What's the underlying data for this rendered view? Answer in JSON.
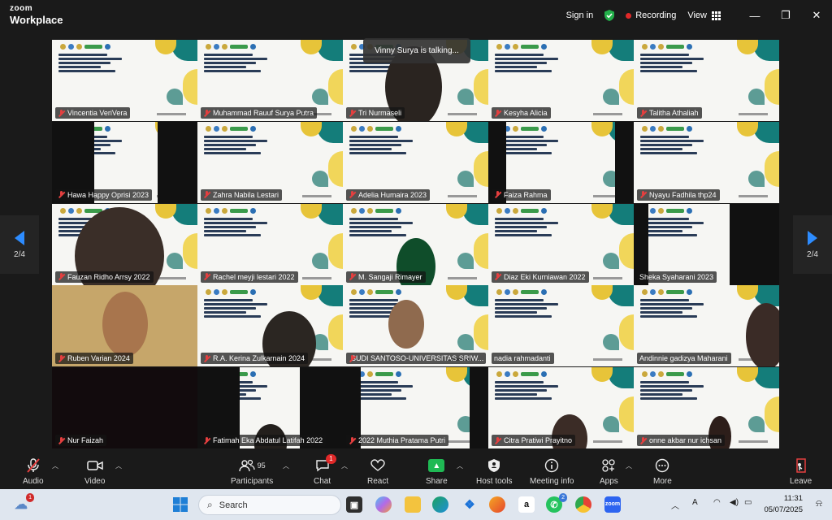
{
  "app": {
    "brand_top": "zoom",
    "brand_bottom": "Workplace"
  },
  "titlebar": {
    "signin": "Sign in",
    "recording": "Recording",
    "view": "View",
    "minimize": "—",
    "maximize": "❐",
    "close": "✕"
  },
  "pager": {
    "left": "2/4",
    "right": "2/4"
  },
  "talking": "Vinny Surya is talking...",
  "participants": [
    {
      "name": "Vincentia VeriVera",
      "muted": true
    },
    {
      "name": "Muhammad Rauuf Surya Putra",
      "muted": true
    },
    {
      "name": "Tri Nurmaseli",
      "muted": true
    },
    {
      "name": "Kesyha Alicia",
      "muted": true
    },
    {
      "name": "Talitha Athaliah",
      "muted": true
    },
    {
      "name": "Hawa Happy Oprisi 2023",
      "muted": true
    },
    {
      "name": "Zahra Nabila Lestari",
      "muted": true
    },
    {
      "name": "Adelia Humaira 2023",
      "muted": true
    },
    {
      "name": "Faiza Rahma",
      "muted": true
    },
    {
      "name": "Nyayu Fadhila thp24",
      "muted": true
    },
    {
      "name": "Fauzan Ridho Arrsy 2022",
      "muted": true
    },
    {
      "name": "Rachel meyji lestari 2022",
      "muted": true
    },
    {
      "name": "M. Sangaji Rimayer",
      "muted": true
    },
    {
      "name": "Diaz Eki Kurniawan 2022",
      "muted": true
    },
    {
      "name": "Sheka Syaharani 2023",
      "muted": false
    },
    {
      "name": "Ruben Varian 2024",
      "muted": true
    },
    {
      "name": "R.A. Kerina Zulkarnain 2024",
      "muted": true
    },
    {
      "name": "BUDI SANTOSO-UNIVERSITAS SRIW...",
      "muted": true
    },
    {
      "name": "nadia rahmadanti",
      "muted": false
    },
    {
      "name": "Andinnie gadizya Maharani",
      "muted": false
    },
    {
      "name": "Nur Faizah",
      "muted": true
    },
    {
      "name": "Fatimah Eka Abdatul Latifah 2022",
      "muted": true
    },
    {
      "name": "2022 Muthia Pratama Putri",
      "muted": true
    },
    {
      "name": "Citra Pratiwi Prayitno",
      "muted": true
    },
    {
      "name": "onne akbar nur ichsan",
      "muted": true
    }
  ],
  "toolbar": {
    "audio": "Audio",
    "video": "Video",
    "participants": "Participants",
    "participants_count": "95",
    "chat": "Chat",
    "chat_badge": "1",
    "react": "React",
    "share": "Share",
    "host_tools": "Host tools",
    "meeting_info": "Meeting info",
    "apps": "Apps",
    "more": "More",
    "leave": "Leave"
  },
  "taskbar": {
    "search_placeholder": "Search",
    "weather_badge": "1",
    "whatsapp_badge": "2",
    "time": "11:31",
    "date": "05/07/2025"
  },
  "colors": {
    "accent": "#2d8cff",
    "recording": "#e02828",
    "share": "#1fb954",
    "muted": "#e43f3f"
  }
}
